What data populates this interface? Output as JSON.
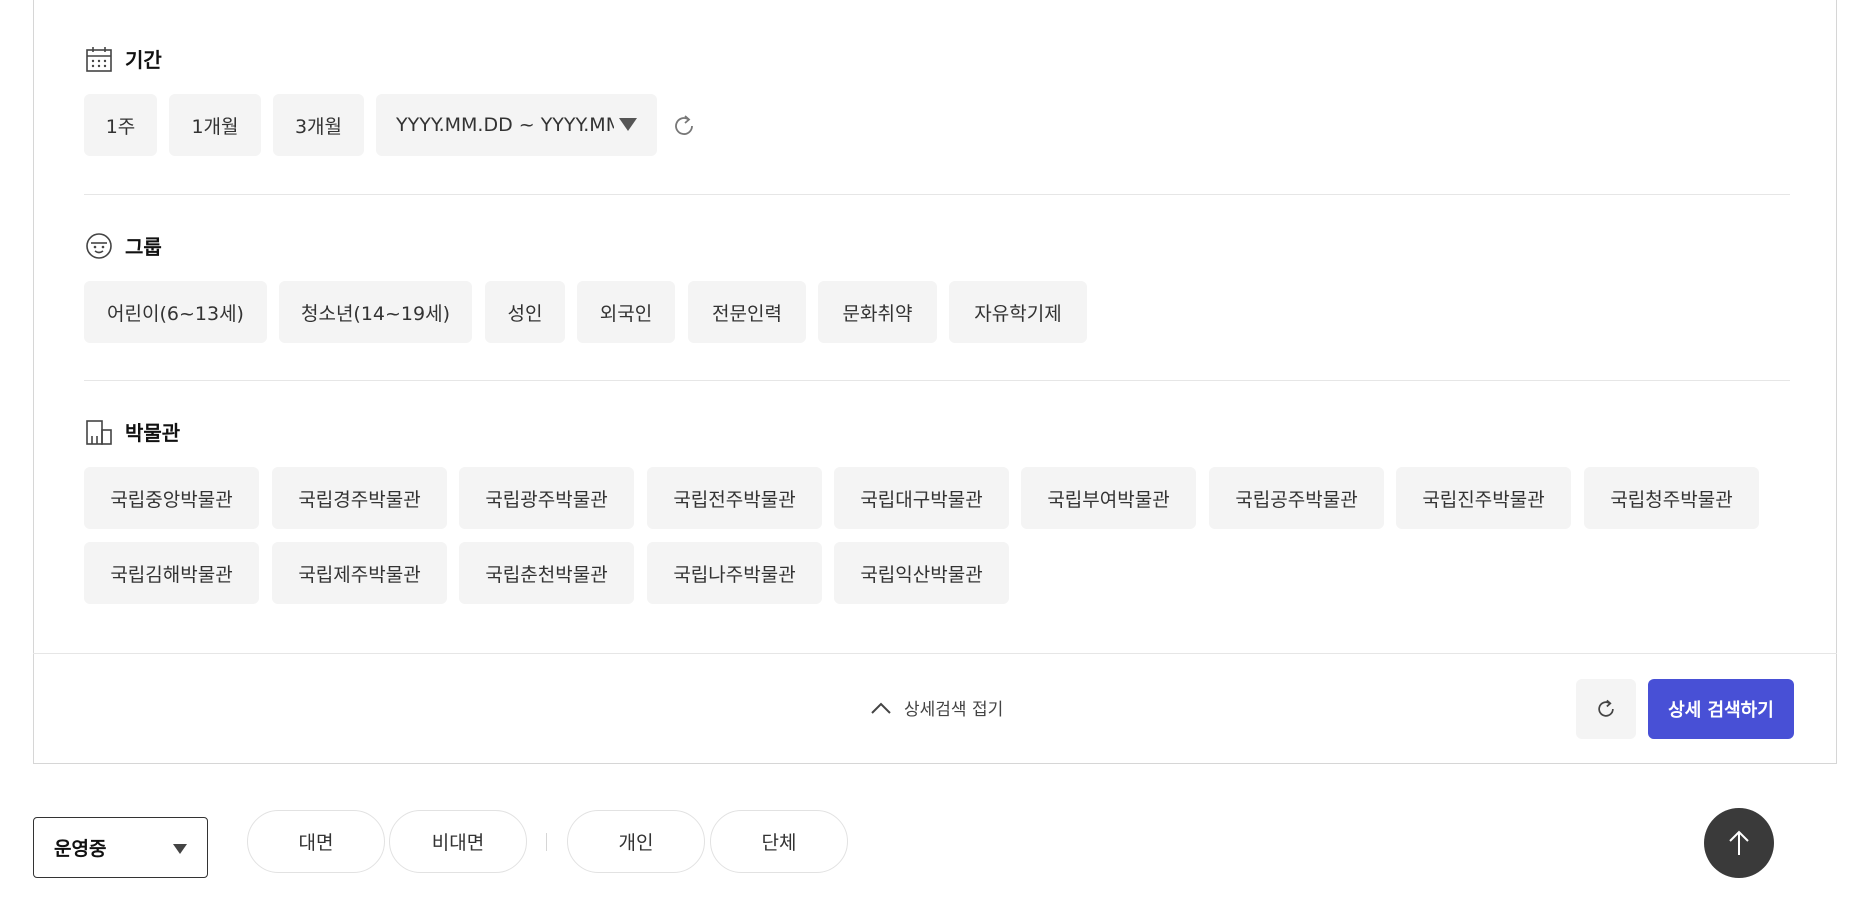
{
  "period": {
    "title": "기간",
    "chips": [
      "1주",
      "1개월",
      "3개월"
    ],
    "date_range": "YYYY.MM.DD ~ YYYY.MM.DD"
  },
  "group": {
    "title": "그룹",
    "chips": [
      "어린이(6~13세)",
      "청소년(14~19세)",
      "성인",
      "외국인",
      "전문인력",
      "문화취약",
      "자유학기제"
    ]
  },
  "museum": {
    "title": "박물관",
    "row1": [
      "국립중앙박물관",
      "국립경주박물관",
      "국립광주박물관",
      "국립전주박물관",
      "국립대구박물관",
      "국립부여박물관",
      "국립공주박물관",
      "국립진주박물관",
      "국립청주박물관"
    ],
    "row2": [
      "국립김해박물관",
      "국립제주박물관",
      "국립춘천박물관",
      "국립나주박물관",
      "국립익산박물관"
    ]
  },
  "footer": {
    "collapse_label": "상세검색 접기",
    "search_label": "상세 검색하기"
  },
  "filters": {
    "status_value": "운영중",
    "mode": [
      "대면",
      "비대면"
    ],
    "type": [
      "개인",
      "단체"
    ]
  },
  "colors": {
    "primary": "#4850d6",
    "chip_bg": "#f4f4f4"
  }
}
